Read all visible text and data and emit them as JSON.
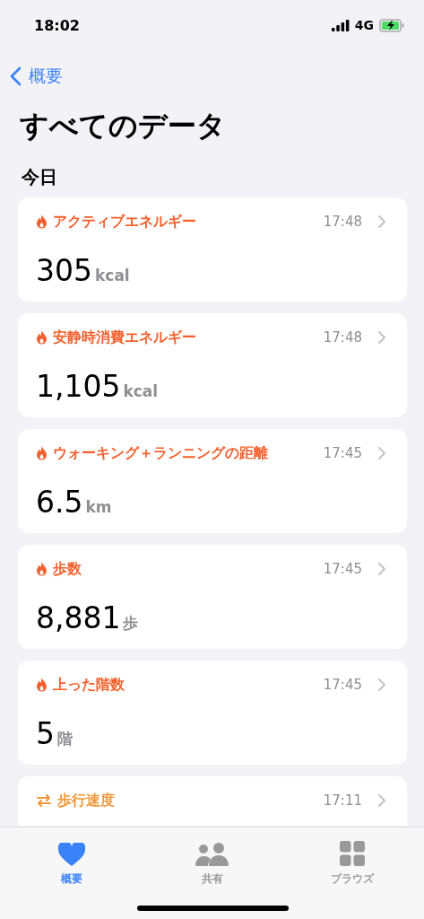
{
  "status_bar": {
    "time": "18:02",
    "network": "4G"
  },
  "nav": {
    "back": "概要"
  },
  "title": "すべてのデータ",
  "section": "今日",
  "cards": [
    {
      "kind": "flame",
      "color": "#f4602d",
      "label": "アクティブエネルギー",
      "time": "17:48",
      "value": "305",
      "unit": "kcal"
    },
    {
      "kind": "flame",
      "color": "#f4602d",
      "label": "安静時消費エネルギー",
      "time": "17:48",
      "value": "1,105",
      "unit": "kcal"
    },
    {
      "kind": "flame",
      "color": "#f4602d",
      "label": "ウォーキング＋ランニングの距離",
      "time": "17:45",
      "value": "6.5",
      "unit": "km"
    },
    {
      "kind": "flame",
      "color": "#f4602d",
      "label": "歩数",
      "time": "17:45",
      "value": "8,881",
      "unit": "歩"
    },
    {
      "kind": "flame",
      "color": "#f4602d",
      "label": "上った階数",
      "time": "17:45",
      "value": "5",
      "unit": "階"
    },
    {
      "kind": "arrows",
      "color": "#f0973a",
      "label": "歩行速度",
      "time": "17:11"
    }
  ],
  "tabs": [
    {
      "kind": "heart",
      "label": "概要",
      "selected": true
    },
    {
      "kind": "people",
      "label": "共有",
      "selected": false
    },
    {
      "kind": "grid",
      "label": "ブラウズ",
      "selected": false
    }
  ]
}
